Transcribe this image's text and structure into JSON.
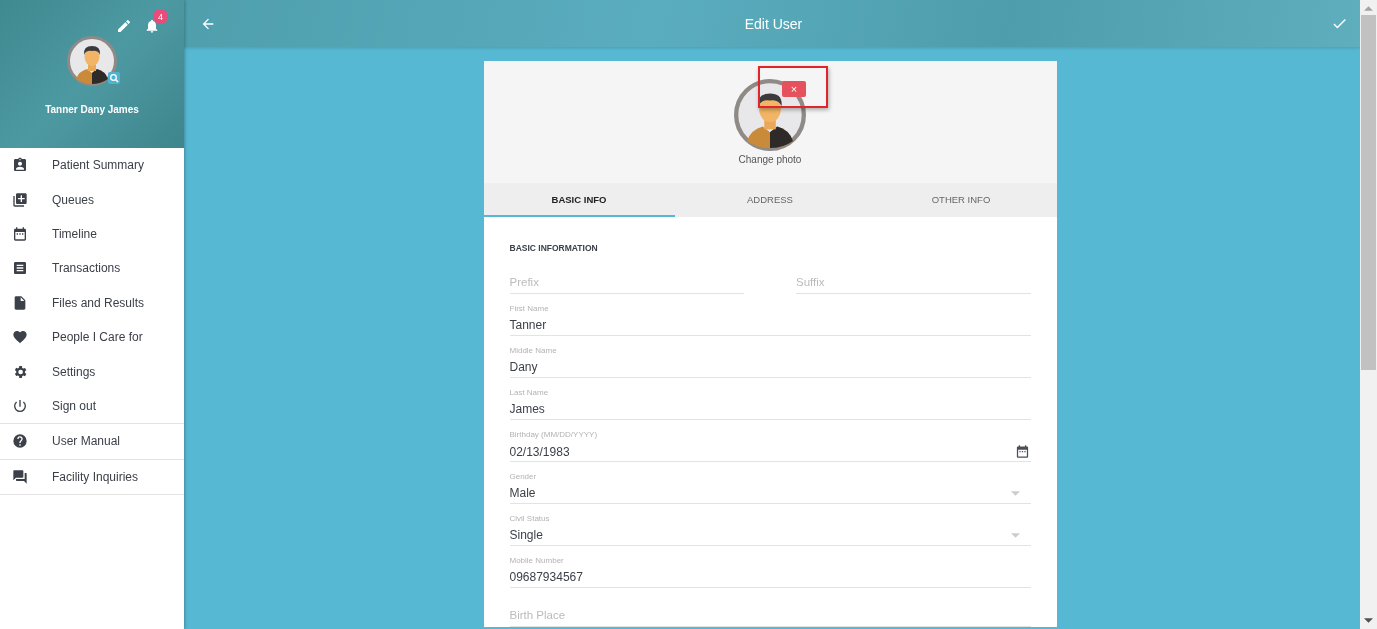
{
  "header": {
    "title": "Edit User"
  },
  "profile": {
    "name": "Tanner Dany James",
    "notification_count": "4"
  },
  "menu_groups": [
    [
      {
        "label": "Patient Summary"
      },
      {
        "label": "Queues"
      },
      {
        "label": "Timeline"
      },
      {
        "label": "Transactions"
      },
      {
        "label": "Files and Results"
      },
      {
        "label": "People I Care for"
      },
      {
        "label": "Settings"
      },
      {
        "label": "Sign out"
      }
    ],
    [
      {
        "label": "User Manual"
      }
    ],
    [
      {
        "label": "Facility Inquiries"
      }
    ]
  ],
  "photo": {
    "remove_button": "×",
    "change_link": "Change photo"
  },
  "tabs": [
    {
      "label": "BASIC INFO",
      "selected": true
    },
    {
      "label": "ADDRESS",
      "selected": false
    },
    {
      "label": "OTHER INFO",
      "selected": false
    }
  ],
  "section_title": "BASIC INFORMATION",
  "name_affixes": [
    {
      "placeholder": "Prefix"
    },
    {
      "placeholder": "Suffix"
    }
  ],
  "fields": [
    {
      "kind": "text",
      "label": "First Name",
      "value": "Tanner"
    },
    {
      "kind": "text",
      "label": "Middle Name",
      "value": "Dany"
    },
    {
      "kind": "text",
      "label": "Last Name",
      "value": "James"
    },
    {
      "kind": "date",
      "label": "Birthday (MM/DD/YYYY)",
      "value": "02/13/1983"
    },
    {
      "kind": "select",
      "label": "Gender",
      "value": "Male"
    },
    {
      "kind": "select",
      "label": "Civil Status",
      "value": "Single"
    },
    {
      "kind": "text",
      "label": "Mobile Number",
      "value": "09687934567"
    },
    {
      "kind": "empty",
      "placeholder": "Birth Place"
    }
  ]
}
